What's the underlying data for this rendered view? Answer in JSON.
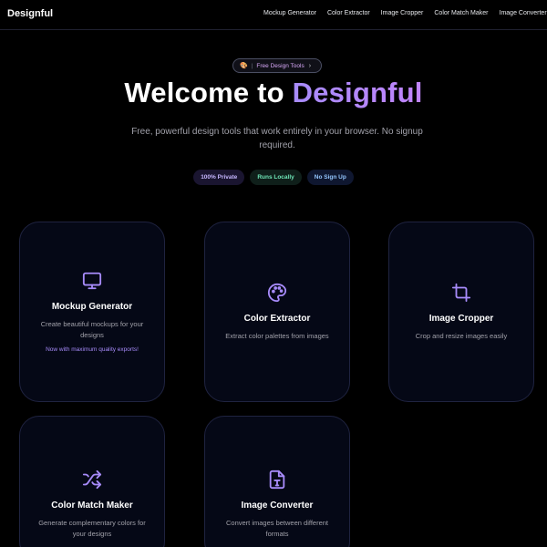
{
  "brand": "Designful",
  "nav": {
    "links": [
      "Mockup Generator",
      "Color Extractor",
      "Image Cropper",
      "Color Match Maker",
      "Image Converter"
    ]
  },
  "hero": {
    "pill_icon": "palette-emoji",
    "pill_sep": "|",
    "pill_text": "Free Design Tools",
    "pill_chevron": "›",
    "title_plain": "Welcome to ",
    "title_accent": "Designful",
    "subtitle": "Free, powerful design tools that work entirely in your browser. No signup required.",
    "badges": [
      "100% Private",
      "Runs Locally",
      "No Sign Up"
    ]
  },
  "colors": {
    "accent": "#a78bfa",
    "card_bg": "#050816",
    "background": "#000000"
  },
  "cards": [
    {
      "icon": "monitor-icon",
      "title": "Mockup Generator",
      "desc": "Create beautiful mockups for your designs",
      "note": "Now with maximum quality exports!"
    },
    {
      "icon": "palette-icon",
      "title": "Color Extractor",
      "desc": "Extract color palettes from images"
    },
    {
      "icon": "crop-icon",
      "title": "Image Cropper",
      "desc": "Crop and resize images easily"
    },
    {
      "icon": "shuffle-icon",
      "title": "Color Match Maker",
      "desc": "Generate complementary colors for your designs"
    },
    {
      "icon": "file-type-icon",
      "title": "Image Converter",
      "desc": "Convert images between different formats"
    }
  ]
}
